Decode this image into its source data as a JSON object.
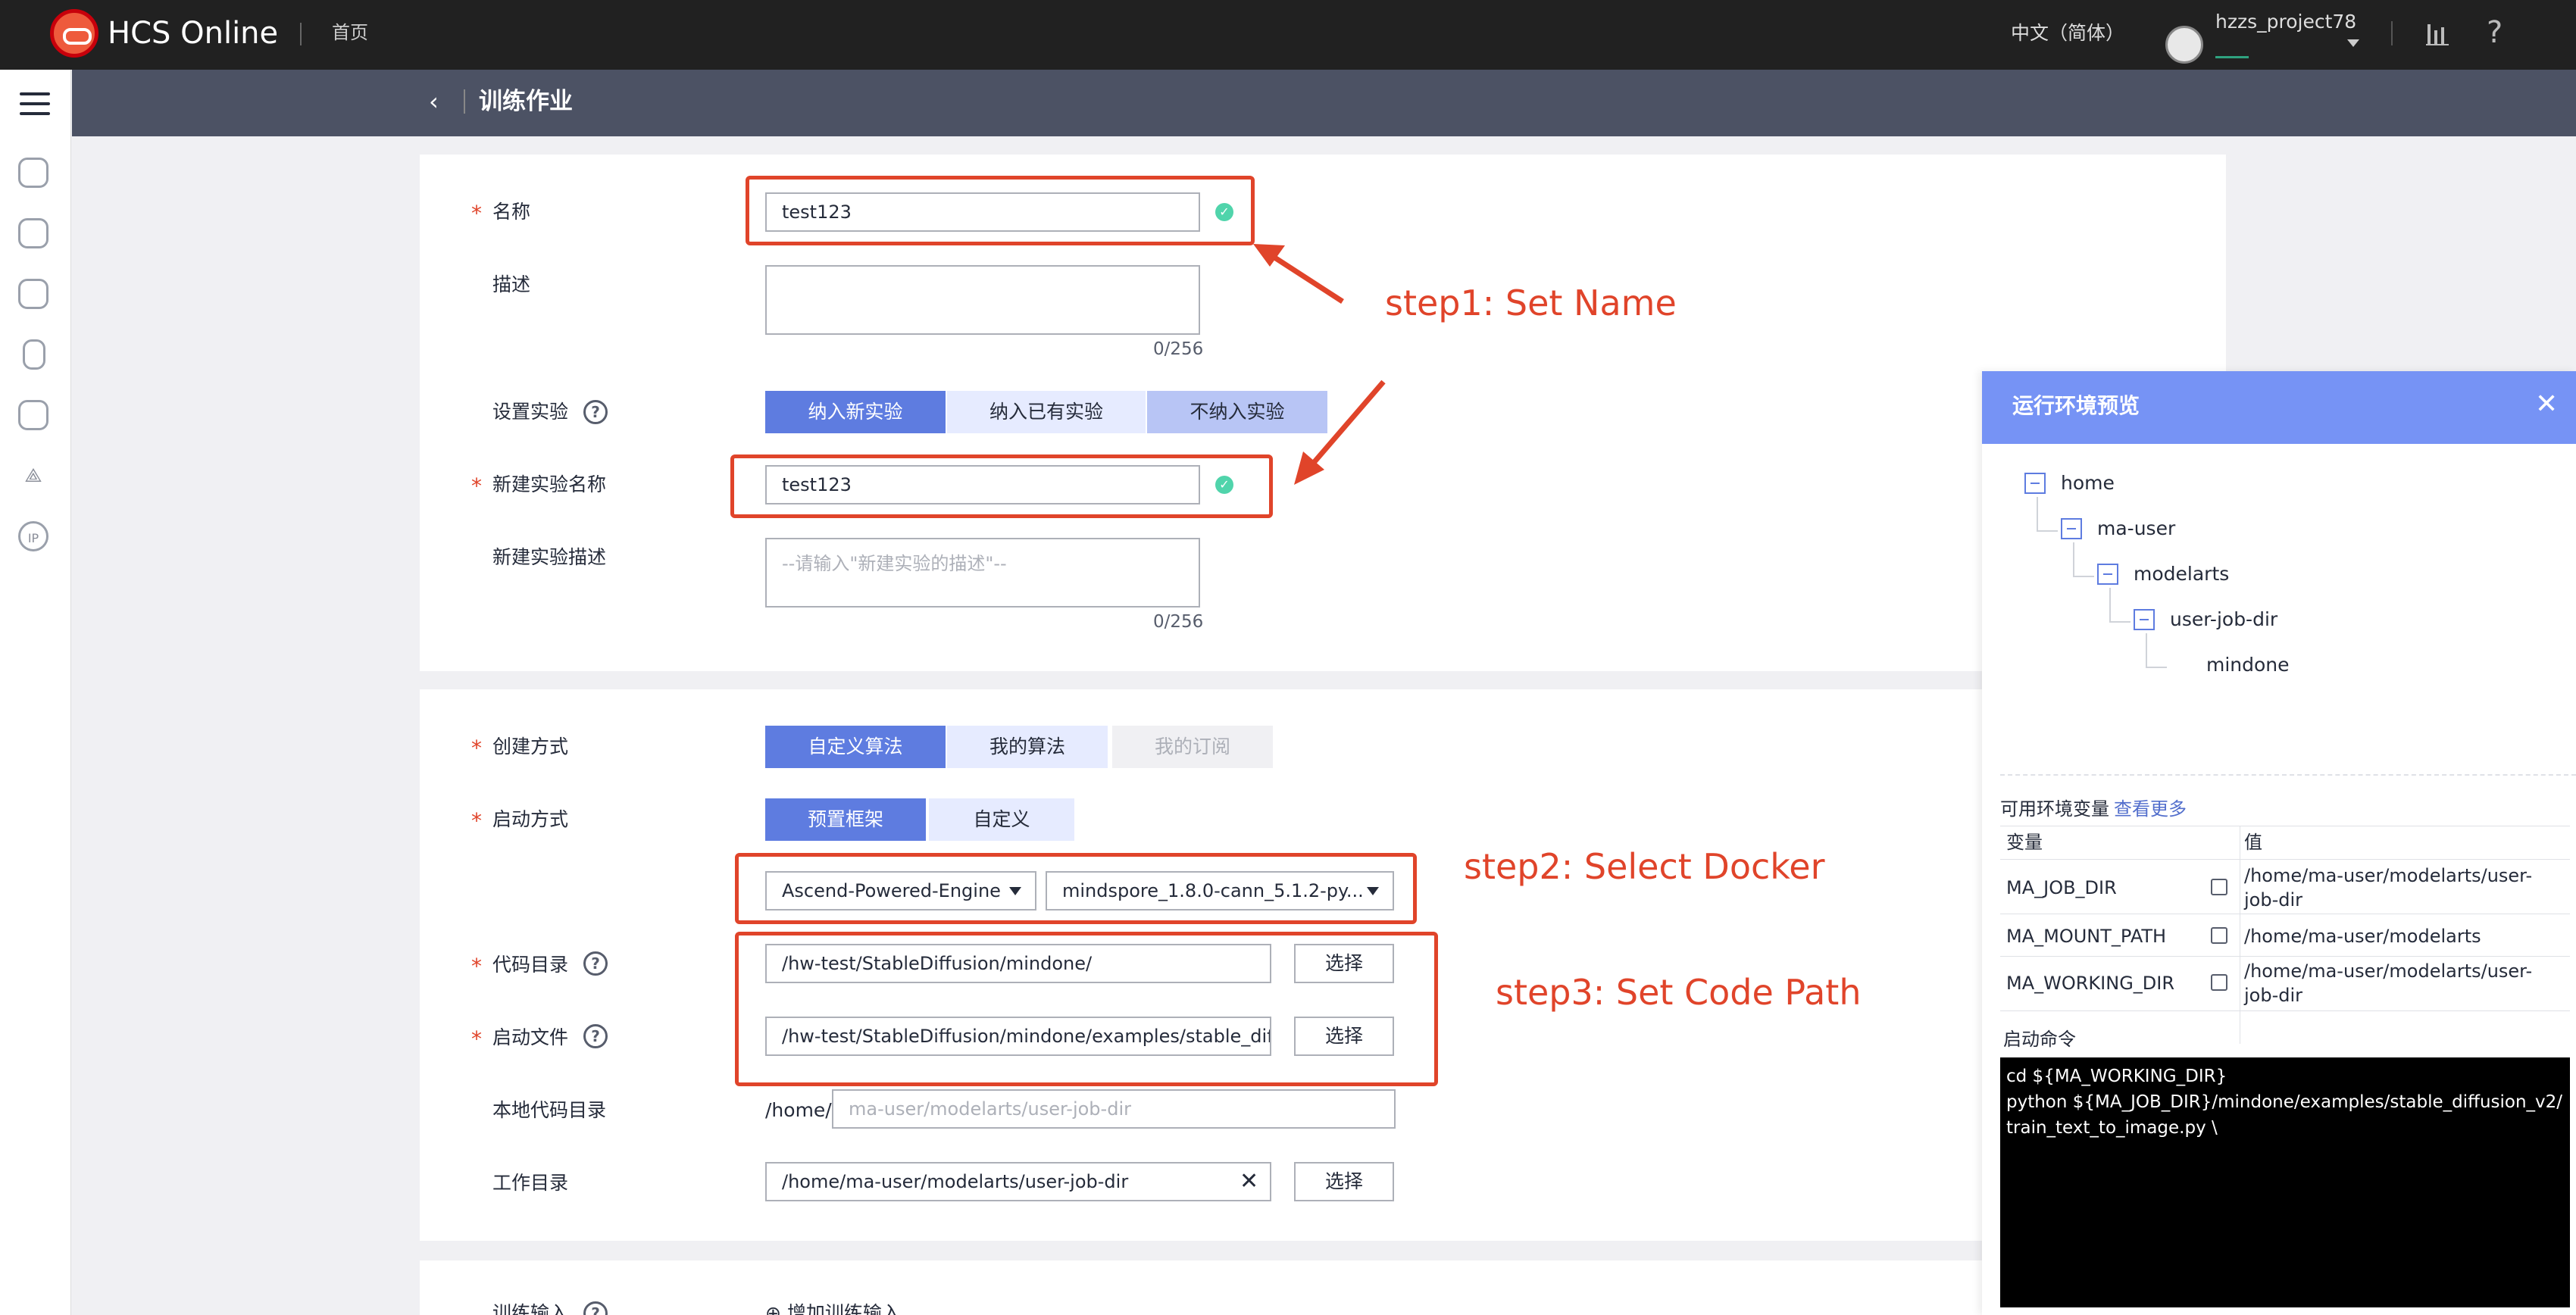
{
  "topbar": {
    "brand": "HCS Online",
    "home": "首页",
    "language": "中文（简体）",
    "username": "hzzs_project78"
  },
  "header": {
    "title": "训练作业"
  },
  "form1": {
    "name_label": "名称",
    "name_value": "test123",
    "desc_label": "描述",
    "desc_counter": "0/256",
    "experiment_label": "设置实验",
    "experiment_options": [
      "纳入新实验",
      "纳入已有实验",
      "不纳入实验"
    ],
    "new_exp_name_label": "新建实验名称",
    "new_exp_name_value": "test123",
    "new_exp_desc_label": "新建实验描述",
    "new_exp_desc_placeholder": "--请输入\"新建实验的描述\"--",
    "new_exp_desc_counter": "0/256"
  },
  "form2": {
    "create_label": "创建方式",
    "create_options": [
      "自定义算法",
      "我的算法",
      "我的订阅"
    ],
    "launch_label": "启动方式",
    "launch_options": [
      "预置框架",
      "自定义"
    ],
    "engine_value": "Ascend-Powered-Engine",
    "image_value": "mindspore_1.8.0-cann_5.1.2-py...",
    "code_dir_label": "代码目录",
    "code_dir_value": "/hw-test/StableDiffusion/mindone/",
    "startup_label": "启动文件",
    "startup_value": "/hw-test/StableDiffusion/mindone/examples/stable_diffus",
    "select_btn": "选择",
    "local_dir_label": "本地代码目录",
    "local_dir_prefix": "/home/",
    "local_dir_placeholder": "ma-user/modelarts/user-job-dir",
    "work_dir_label": "工作目录",
    "work_dir_value": "/home/ma-user/modelarts/user-job-dir"
  },
  "form3": {
    "input_label": "训练输入",
    "add_input": "增加训练输入"
  },
  "annotations": {
    "step1": "step1: Set Name",
    "step2": "step2: Select Docker",
    "step3": "step3: Set Code Path"
  },
  "panel": {
    "title": "运行环境预览",
    "tree": [
      "home",
      "ma-user",
      "modelarts",
      "user-job-dir",
      "mindone"
    ],
    "env_label": "可用环境变量",
    "env_more": "查看更多",
    "col_var": "变量",
    "col_val": "值",
    "env_rows": [
      {
        "name": "MA_JOB_DIR",
        "value": "/home/ma-user/modelarts/user-job-dir"
      },
      {
        "name": "MA_MOUNT_PATH",
        "value": "/home/ma-user/modelarts"
      },
      {
        "name": "MA_WORKING_DIR",
        "value": "/home/ma-user/modelarts/user-job-dir"
      }
    ],
    "cmd_label": "启动命令",
    "cmd_line1": "cd ${MA_WORKING_DIR}",
    "cmd_line2": "python ${MA_JOB_DIR}/mindone/examples/stable_diffusion_v2/train_text_to_image.py \\"
  },
  "colors": {
    "accent": "#5e7ce0",
    "annotation": "#e0442a",
    "topbar": "#212121",
    "pageheader": "#4c5264",
    "panelheader": "#7693f5"
  }
}
